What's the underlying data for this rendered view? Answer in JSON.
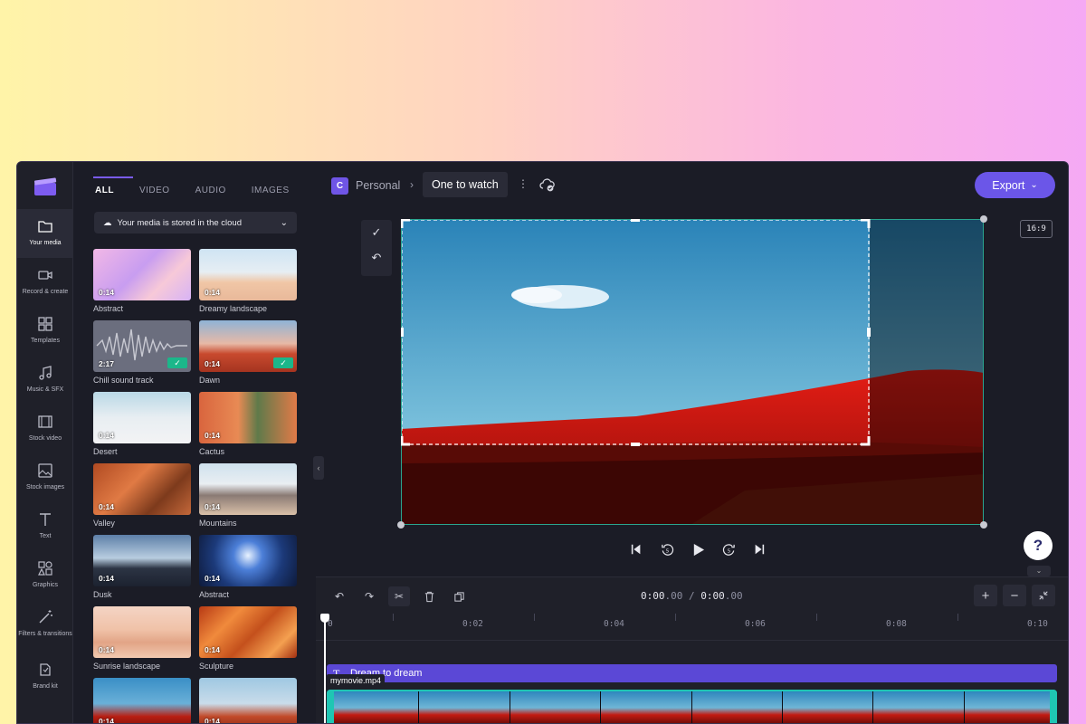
{
  "rail": {
    "items": [
      {
        "label": "Your media",
        "icon": "folder-icon"
      },
      {
        "label": "Record & create",
        "icon": "camera-icon"
      },
      {
        "label": "Templates",
        "icon": "templates-icon"
      },
      {
        "label": "Music & SFX",
        "icon": "music-icon"
      },
      {
        "label": "Stock video",
        "icon": "film-icon"
      },
      {
        "label": "Stock images",
        "icon": "image-icon"
      },
      {
        "label": "Text",
        "icon": "text-icon"
      },
      {
        "label": "Graphics",
        "icon": "shapes-icon"
      },
      {
        "label": "Filters & transitions",
        "icon": "magic-wand-icon"
      },
      {
        "label": "Brand kit",
        "icon": "brand-kit-icon"
      }
    ]
  },
  "media": {
    "tabs": [
      "ALL",
      "VIDEO",
      "AUDIO",
      "IMAGES"
    ],
    "cloud_notice": "Your media is stored in the cloud",
    "items": [
      {
        "title": "Abstract",
        "duration": "0:14",
        "added": false
      },
      {
        "title": "Dreamy landscape",
        "duration": "0:14",
        "added": false
      },
      {
        "title": "Chill sound track",
        "duration": "2:17",
        "added": true
      },
      {
        "title": "Dawn",
        "duration": "0:14",
        "added": true
      },
      {
        "title": "Desert",
        "duration": "0:14",
        "added": false
      },
      {
        "title": "Cactus",
        "duration": "0:14",
        "added": false
      },
      {
        "title": "Valley",
        "duration": "0:14",
        "added": false
      },
      {
        "title": "Mountains",
        "duration": "0:14",
        "added": false
      },
      {
        "title": "Dusk",
        "duration": "0:14",
        "added": false
      },
      {
        "title": "Abstract",
        "duration": "0:14",
        "added": false
      },
      {
        "title": "Sunrise landscape",
        "duration": "0:14",
        "added": false
      },
      {
        "title": "Sculpture",
        "duration": "0:14",
        "added": false
      },
      {
        "title": "",
        "duration": "0:14",
        "added": false
      },
      {
        "title": "",
        "duration": "0:14",
        "added": false
      }
    ]
  },
  "topbar": {
    "workspace_initial": "C",
    "workspace_name": "Personal",
    "project_name": "One to watch",
    "export_label": "Export"
  },
  "preview": {
    "aspect_ratio": "16:9"
  },
  "timeline": {
    "current_time": "0:00",
    "current_frac": ".00",
    "total_time": "0:00",
    "total_frac": ".00",
    "ruler_ticks": [
      "0",
      "0:02",
      "0:04",
      "0:06",
      "0:08",
      "0:10"
    ],
    "text_clip": "Dream to dream",
    "video_clip": "mymovie.mp4"
  },
  "help_label": "?"
}
